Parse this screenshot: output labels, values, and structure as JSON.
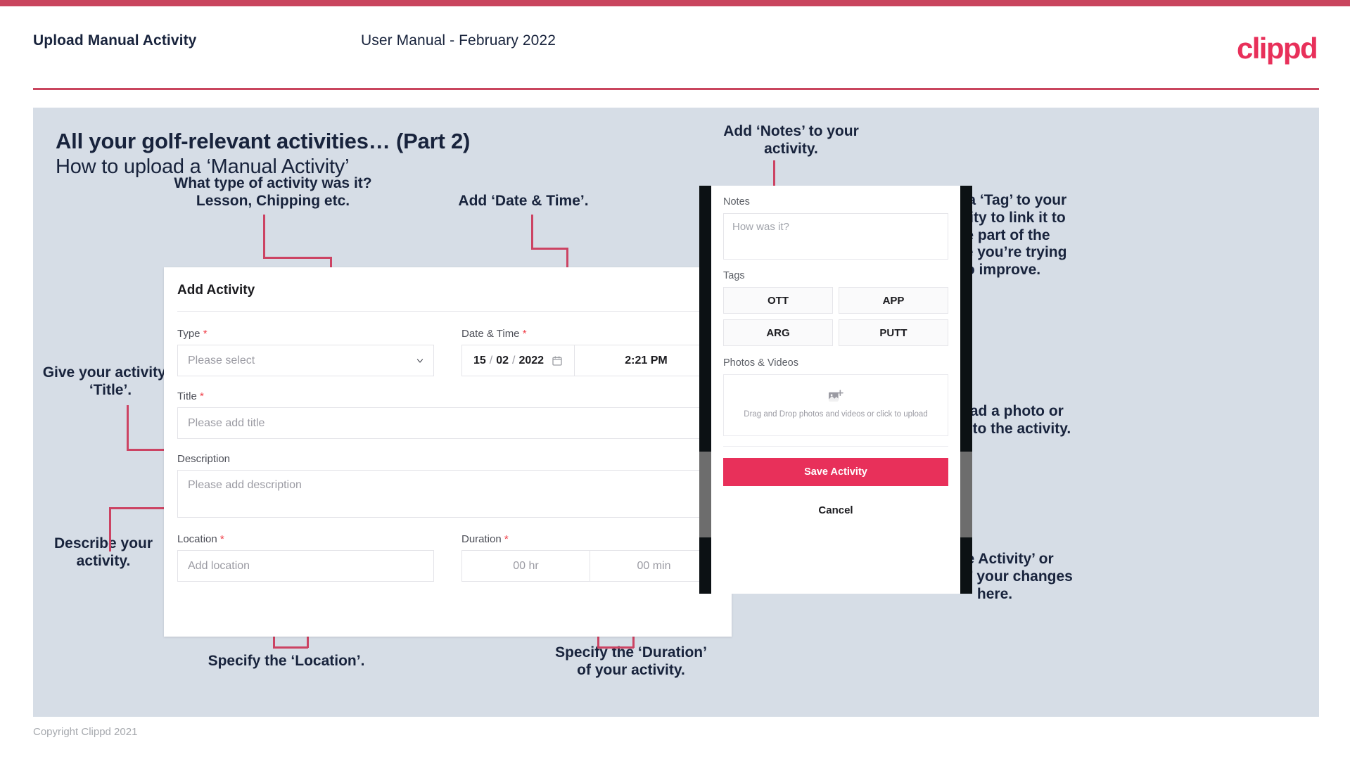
{
  "header": {
    "title": "Upload Manual Activity",
    "subtitle": "User Manual - February 2022",
    "logo": "clippd"
  },
  "slide": {
    "title": "All your golf-relevant activities… (Part 2)",
    "subtitle": "How to upload a ‘Manual Activity’"
  },
  "annotations": {
    "type": "What type of activity was it?\nLesson, Chipping etc.",
    "datetime": "Add ‘Date & Time’.",
    "title": "Give your activity a\n‘Title’.",
    "description": "Describe your\nactivity.",
    "location": "Specify the ‘Location’.",
    "duration": "Specify the ‘Duration’\nof your activity.",
    "notes": "Add ‘Notes’ to your\nactivity.",
    "tags": "Add a ‘Tag’ to your\nactivity to link it to\nthe part of the\ngame you’re trying\nto improve.",
    "upload": "Upload a photo or\nvideo to the activity.",
    "save": "‘Save Activity’ or\n‘Cancel’ your changes\nhere."
  },
  "dialog": {
    "title": "Add Activity",
    "close_icon": "close-icon",
    "fields": {
      "type": {
        "label": "Type",
        "required": "*",
        "placeholder": "Please select"
      },
      "datetime": {
        "label": "Date & Time",
        "required": "*",
        "day": "15",
        "month": "02",
        "year": "2022",
        "sep": "/",
        "time": "2:21 PM"
      },
      "title": {
        "label": "Title",
        "required": "*",
        "placeholder": "Please add title"
      },
      "description": {
        "label": "Description",
        "placeholder": "Please add description"
      },
      "location": {
        "label": "Location",
        "required": "*",
        "placeholder": "Add location"
      },
      "duration": {
        "label": "Duration",
        "required": "*",
        "hours_placeholder": "00 hr",
        "minutes_placeholder": "00 min"
      }
    }
  },
  "phone": {
    "notes": {
      "label": "Notes",
      "placeholder": "How was it?"
    },
    "tags": {
      "label": "Tags",
      "items": [
        "OTT",
        "APP",
        "ARG",
        "PUTT"
      ]
    },
    "media": {
      "label": "Photos & Videos",
      "dropzone_text": "Drag and Drop photos and videos or click to upload",
      "icon": "add-image-icon"
    },
    "save_label": "Save Activity",
    "cancel_label": "Cancel"
  },
  "footer": {
    "copyright": "Copyright Clippd 2021"
  },
  "colors": {
    "accent": "#c9455e",
    "brand": "#e8305a",
    "slide_bg": "#d6dde6",
    "text": "#18233c",
    "leader": "#cc4363"
  }
}
